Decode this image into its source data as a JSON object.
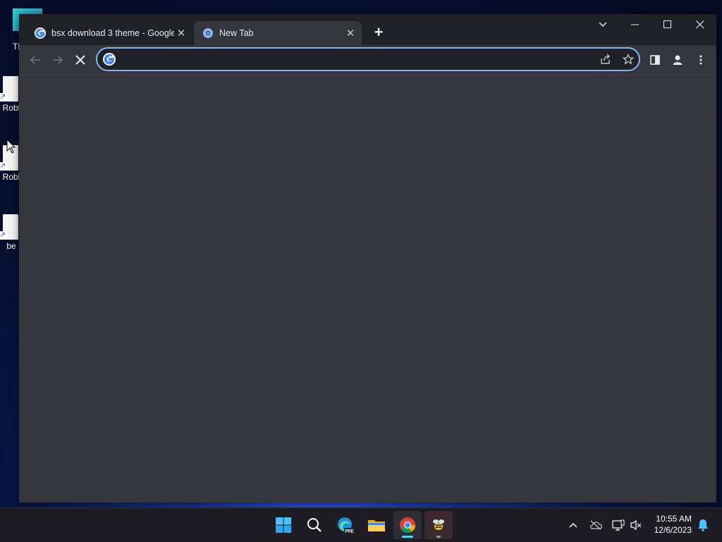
{
  "desktop": {
    "top_icon_label": "Th",
    "icons": [
      {
        "label": "Robl"
      },
      {
        "label": "Robl"
      },
      {
        "label": "be"
      }
    ]
  },
  "browser": {
    "tabs": [
      {
        "title": "bsx download 3 theme - Google",
        "favicon": "google-g-icon",
        "active": false
      },
      {
        "title": "New Tab",
        "favicon": "chrome-newtab-icon",
        "active": true
      }
    ],
    "omnibox": {
      "value": "",
      "placeholder": ""
    },
    "accent_color": "#8ab4f8",
    "content_bg": "#35363a"
  },
  "taskbar": {
    "apps": [
      {
        "name": "windows-start-icon"
      },
      {
        "name": "search-icon"
      },
      {
        "name": "edge-preview-icon",
        "badge": "PRE"
      },
      {
        "name": "file-explorer-icon"
      },
      {
        "name": "chrome-icon",
        "active": true
      },
      {
        "name": "bee-app-icon",
        "running": true
      }
    ],
    "clock": {
      "time": "10:55 AM",
      "date": "12/6/2023"
    }
  }
}
